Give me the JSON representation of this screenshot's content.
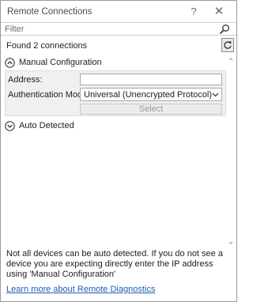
{
  "window": {
    "title": "Remote Connections",
    "help_symbol": "?",
    "close_symbol": "✕"
  },
  "filter": {
    "placeholder": "Filter",
    "search_icon": "search-icon"
  },
  "status": {
    "found_text": "Found 2 connections",
    "refresh_icon": "refresh-icon"
  },
  "manual_section": {
    "label": "Manual Configuration",
    "expanded": true,
    "address_label": "Address:",
    "address_value": "",
    "auth_label": "Authentication Mode:",
    "auth_value": "Universal (Unencrypted Protocol)",
    "select_label": "Select"
  },
  "auto_section": {
    "label": "Auto Detected",
    "expanded": false
  },
  "footer": {
    "note": "Not all devices can be auto detected. If you do not see a device you are expecting directly enter the IP address using 'Manual Configuration'",
    "link_label": "Learn more about Remote Diagnostics"
  },
  "colors": {
    "link": "#1e5fb4",
    "panel_background": "#f0f0f0",
    "border": "#9a9a9a"
  }
}
